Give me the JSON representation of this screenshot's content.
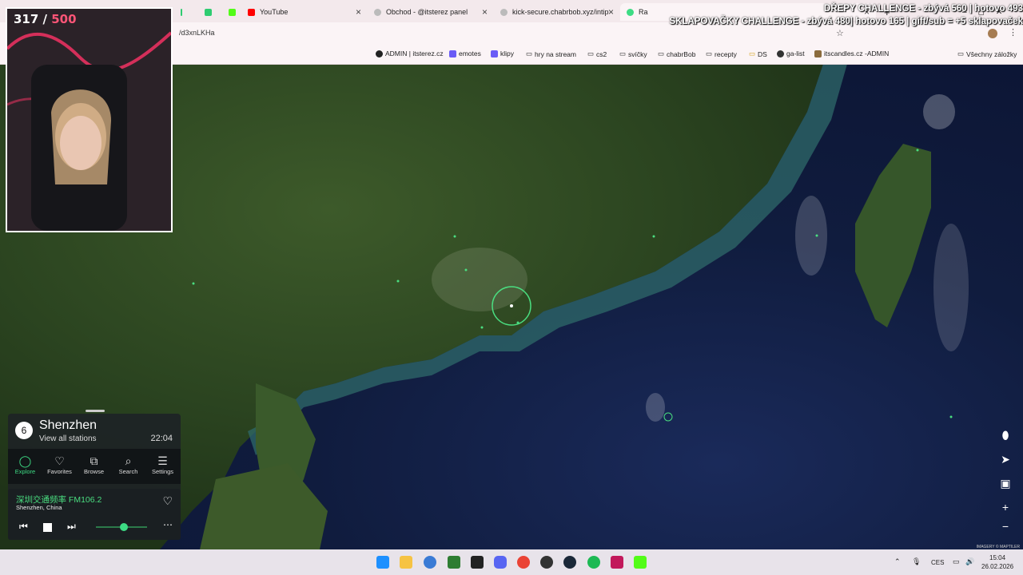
{
  "overlay": {
    "line1": "DŘEPY CHALLENGE - zbývá 560 | hotovo 493",
    "line2": "SKLAPOVAČKY CHALLENGE - zbývá 480| hotovo 165 | gift/sub = +5 sklapovaček",
    "counter_current": "317",
    "counter_sep": " / ",
    "counter_max": "500"
  },
  "browser": {
    "tabs": [
      "YouTube",
      "Obchod - @itsterez panel",
      "kick-secure.chabrbob.xyz/intip",
      "Ra"
    ],
    "url": "/d3xnLKHa",
    "bookmarks": [
      "ADMIN | itsterez.cz",
      "emotes",
      "klipy",
      "hry na stream",
      "cs2",
      "svíčky",
      "chabrBob",
      "recepty",
      "DS",
      "ga-list",
      "itscandles.cz -ADMIN",
      "Všechny záložky"
    ]
  },
  "radio": {
    "station_count": "6",
    "city": "Shenzhen",
    "view_all": "View all stations",
    "local_time": "22:04",
    "nav": [
      {
        "label": "Explore",
        "icon": "◯"
      },
      {
        "label": "Favorites",
        "icon": "♡"
      },
      {
        "label": "Browse",
        "icon": "⧉"
      },
      {
        "label": "Search",
        "icon": "⌕"
      },
      {
        "label": "Settings",
        "icon": "☰"
      }
    ],
    "station_name": "深圳交通频率 FM106.2",
    "station_location": "Shenzhen, China",
    "volume": 0.55
  },
  "map": {
    "attribution": "IMAGERY © MAPTILER"
  },
  "taskbar": {
    "lang": "CES",
    "time": "15:04",
    "date": "26.02.2026"
  },
  "colors": {
    "accent": "#3ddc84",
    "counter_max": "#ff5577"
  }
}
